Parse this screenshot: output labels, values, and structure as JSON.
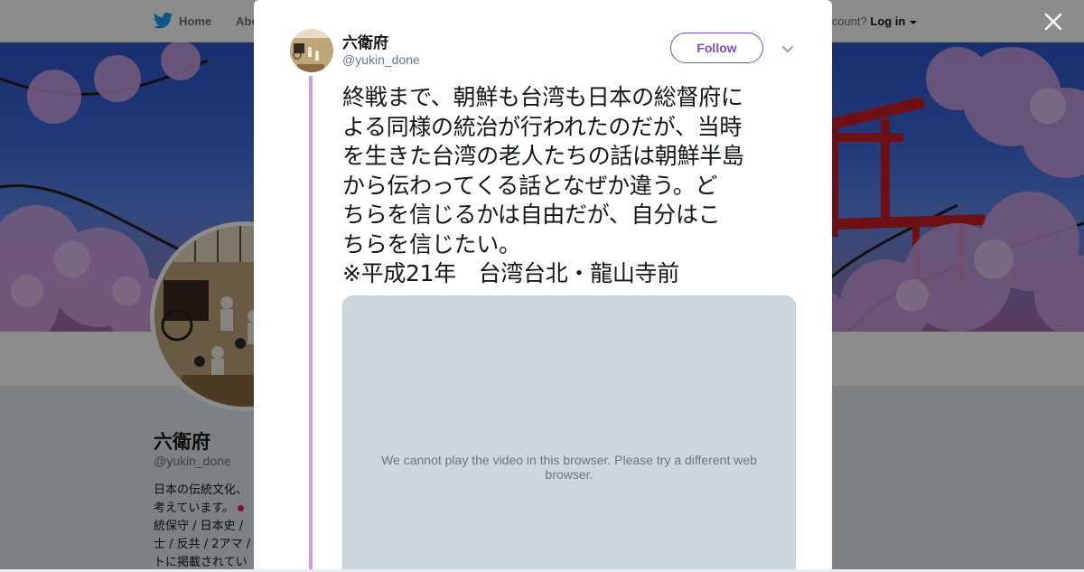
{
  "nav": {
    "home_label": "Home",
    "about_label": "Abo",
    "login_prompt": "ccount?",
    "login_label": "Log in"
  },
  "profile": {
    "name": "六衛府",
    "handle": "@yukin_done",
    "bio_lines": [
      "日本の伝統文化、",
      "考えています。",
      "統保守 / 日本史 / ",
      "士 / 反共 / 2アマ / ",
      "トに掲載されてい"
    ]
  },
  "tweet": {
    "author_name": "六衛府",
    "author_handle": "@yukin_done",
    "follow_label": "Follow",
    "text": "終戦まで、朝鮮も台湾も日本の総督府に\nよる同様の統治が行われたのだが、当時\nを生きた台湾の老人たちの話は朝鮮半島\nから伝わってくる話となぜか違う。ど\nちらを信じるかは自由だが、自分はこ\nちらを信じたい。\n※平成21年　台湾台北・龍山寺前",
    "video_message": "We cannot play the video in this browser. Please try a different web browser."
  },
  "colors": {
    "accent": "#794bc4",
    "thread_line": "#c7a0e0",
    "twitter_blue": "#1da1f2",
    "video_bg": "#ccd6dd"
  },
  "icons": [
    "twitter-bird-icon",
    "close-icon",
    "chevron-down-icon",
    "caret-down-icon"
  ]
}
